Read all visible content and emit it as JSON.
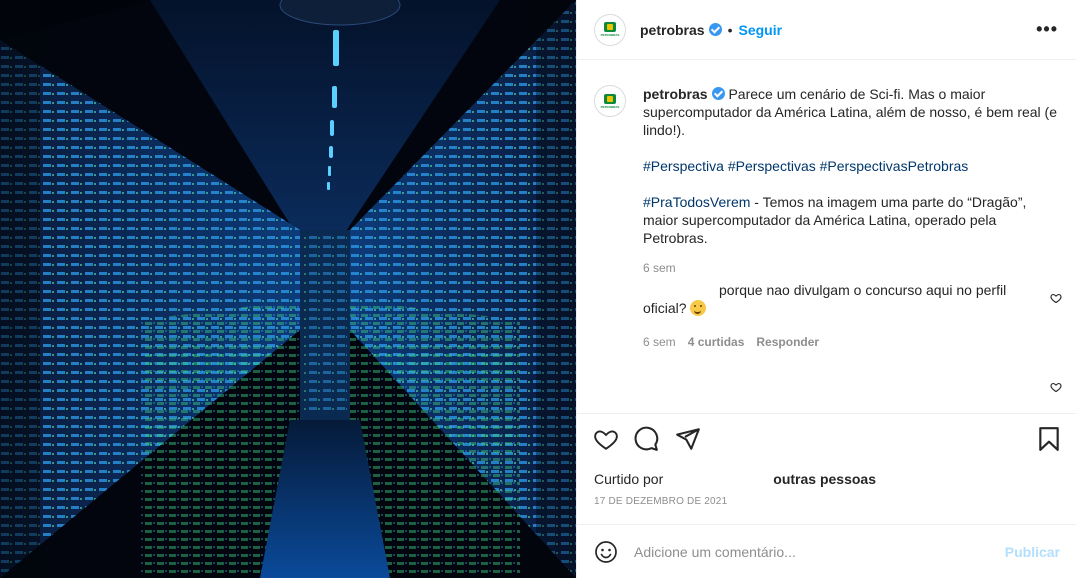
{
  "post": {
    "media_alt": "Supercomputador Dragão",
    "avatar_text": "PETROBRAS",
    "username": "petrobras",
    "follow_label": "Seguir",
    "more_label": "•••",
    "dot": "•"
  },
  "caption": {
    "username": "petrobras",
    "text_line": "Parece um cenário de Sci-fi. Mas o maior supercomputador da América Latina, além de nosso, é bem real (e lindo!).",
    "hashtags": "#Perspectiva #Perspectivas #PerspectivasPetrobras",
    "alt_tag": "#PraTodosVerem",
    "alt_text": " - Temos na imagem uma parte do “Dragão”, maior supercomputador da América Latina, operado pela Petrobras.",
    "time": "6 sem"
  },
  "comments": [
    {
      "text": "porque nao divulgam o concurso aqui no perfil oficial?",
      "time": "6 sem",
      "likes": "4 curtidas",
      "reply": "Responder"
    }
  ],
  "likes": {
    "prefix": "Curtido por",
    "suffix": "outras pessoas"
  },
  "date": "17 DE DEZEMBRO DE 2021",
  "composer": {
    "placeholder": "Adicione um comentário...",
    "publish": "Publicar"
  },
  "icons": {
    "like": "heart-icon",
    "comment": "comment-icon",
    "share": "paper-plane-icon",
    "save": "bookmark-icon",
    "emoji": "smiley-icon",
    "verified": "verified-badge-icon"
  },
  "colors": {
    "accent": "#0095f6",
    "hashtag": "#00376b",
    "muted": "#8e8e8e",
    "publish_disabled": "#b2dffc"
  }
}
